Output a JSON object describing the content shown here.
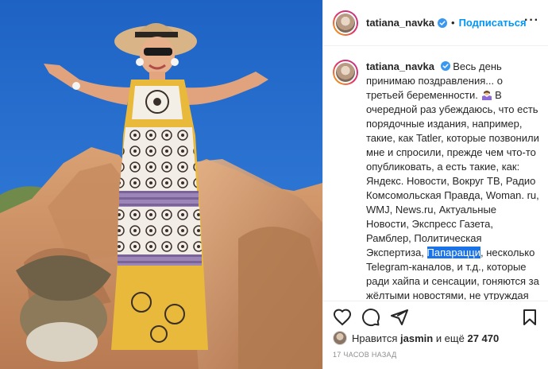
{
  "post": {
    "username": "tatiana_navka",
    "follow_label": "Подписаться",
    "dot": "•",
    "more_icon": "more-horizontal-icon"
  },
  "caption": {
    "username": "tatiana_navka",
    "text_before_highlight": "Весь день принимаю поздравления... о третьей беременности.",
    "text_middle": "В очередной раз убеждаюсь, что есть порядочные издания, например, такие, как Tatler, которые позвонили мне и спросили, прежде чем что-то опубликовать, а есть такие, как: Яндекс. Новости, Вокруг ТВ, Радио Комсомольская Правда, Woman. ru, WMJ, News.ru, Актуальные Новости, Экспресс Газета, Рамблер, Политическая Экспертиза,",
    "highlight": "Папарацци",
    "text_after_highlight": ", несколько Telegram-каналов, и т.д., которые ради хайпа и сенсации, гоняются за жёлтыми новостями, не утруждая себя проверкой информации, а просто основываются на слухах или перепубликовывают якобы новости"
  },
  "likes": {
    "prefix": "Нравится",
    "user": "jasmin",
    "connector": "и ещё",
    "count": "27 470"
  },
  "timestamp": "17 часов назад",
  "colors": {
    "accent": "#0095f6",
    "verified": "#3897f0",
    "highlight": "#1a73e8"
  },
  "icons": [
    "heart-icon",
    "comment-icon",
    "share-icon",
    "bookmark-icon",
    "verified-badge-icon"
  ]
}
